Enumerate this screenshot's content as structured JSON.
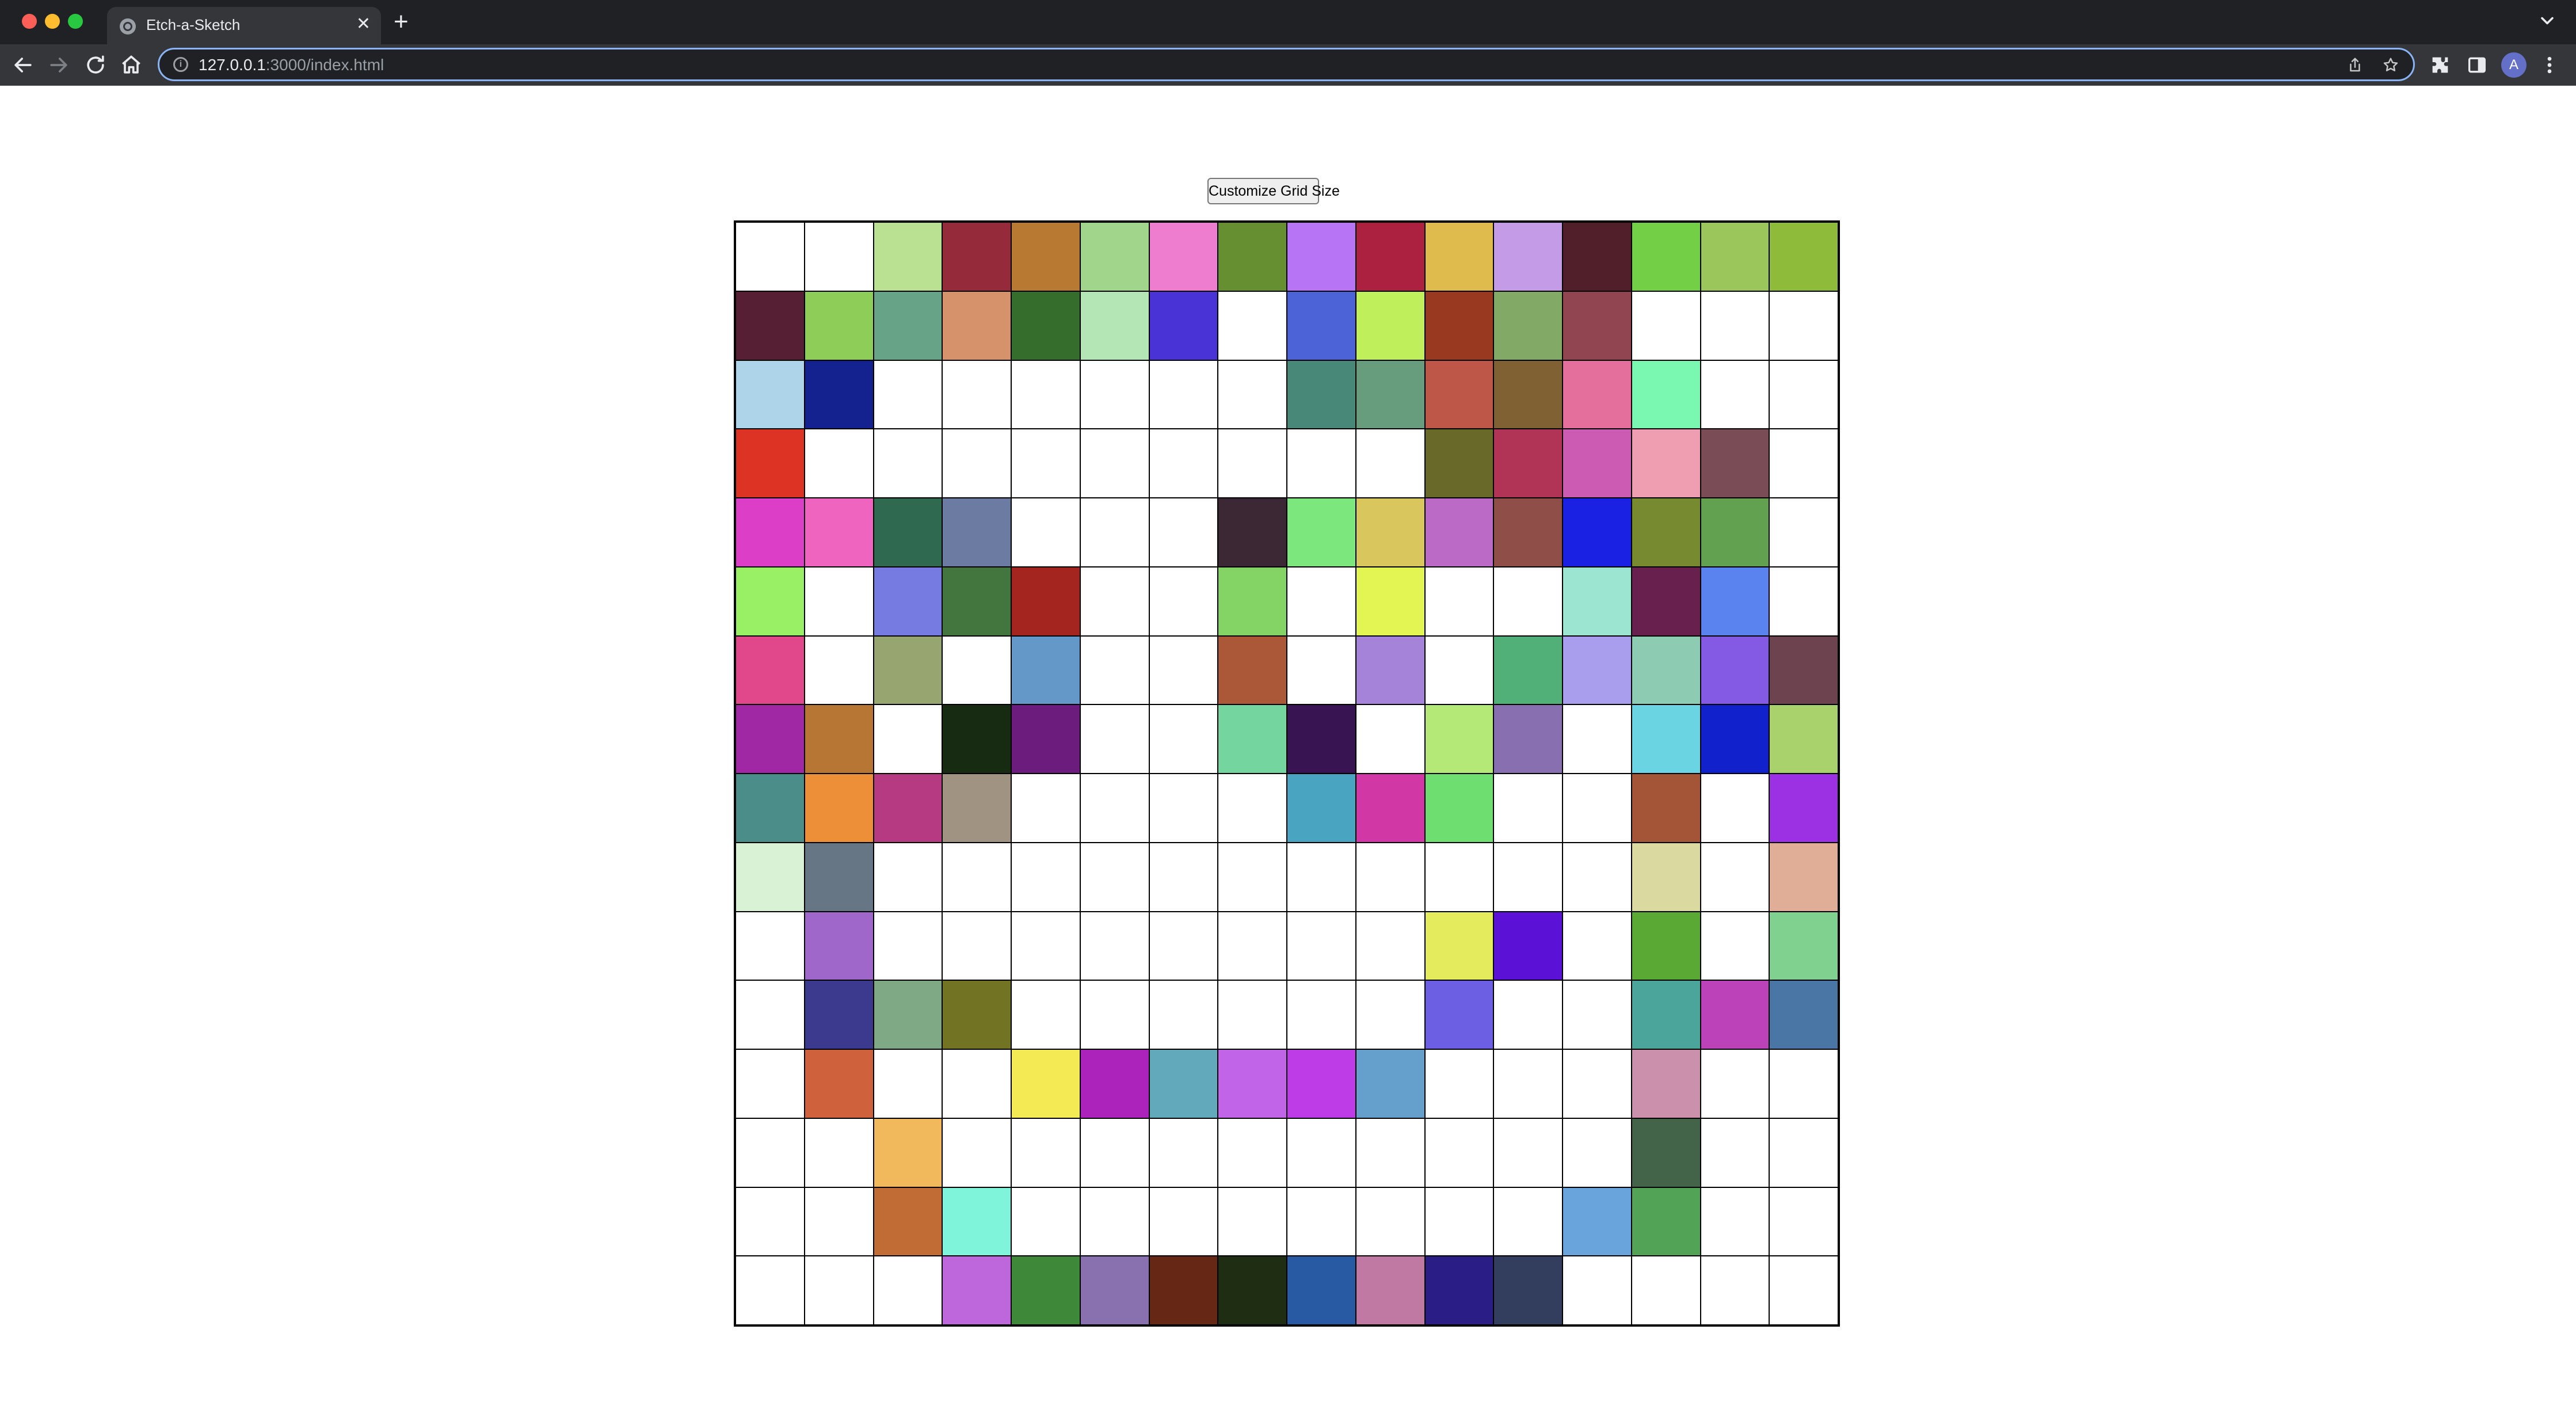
{
  "browser": {
    "tab_title": "Etch-a-Sketch",
    "url_host": "127.0.0.1",
    "url_rest": ":3000/index.html",
    "profile_initial": "A"
  },
  "page": {
    "button_label": "Customize Grid Size"
  },
  "grid": {
    "size": 16,
    "cells": [
      [
        "#ffffff",
        "#ffffff",
        "#bae091",
        "#952a3b",
        "#b87932",
        "#a0d58b",
        "#ef7dcf",
        "#658f31",
        "#b774f5",
        "#ac2140",
        "#dfbb4d",
        "#c49be6",
        "#501f29",
        "#73cf46",
        "#9bc65b",
        "#8fbb3b"
      ],
      [
        "#571f34",
        "#8fcd59",
        "#67a487",
        "#d6926b",
        "#356e2c",
        "#b4e6b5",
        "#4a33d6",
        "#ffffff",
        "#4c63d8",
        "#c0ef5c",
        "#99391f",
        "#83a967",
        "#904550",
        "#ffffff",
        "#ffffff",
        "#ffffff"
      ],
      [
        "#aed4e9",
        "#14228f",
        "#ffffff",
        "#ffffff",
        "#ffffff",
        "#ffffff",
        "#ffffff",
        "#ffffff",
        "#488879",
        "#679d7d",
        "#bf5748",
        "#7f6133",
        "#e46e9c",
        "#7af8b1",
        "#ffffff",
        "#ffffff"
      ],
      [
        "#dd3324",
        "#ffffff",
        "#ffffff",
        "#ffffff",
        "#ffffff",
        "#ffffff",
        "#ffffff",
        "#ffffff",
        "#ffffff",
        "#ffffff",
        "#696a29",
        "#b13456",
        "#cc5cb3",
        "#ef9db1",
        "#7a4d56",
        "#ffffff"
      ],
      [
        "#dc3ec8",
        "#ef64bf",
        "#2e6950",
        "#6c7ba2",
        "#ffffff",
        "#ffffff",
        "#ffffff",
        "#3b2834",
        "#7ce77d",
        "#d9c65d",
        "#bb6ac5",
        "#8f4f48",
        "#1b21e2",
        "#788a2f",
        "#62a150",
        "#ffffff"
      ],
      [
        "#99f064",
        "#ffffff",
        "#757be0",
        "#43763e",
        "#a4251f",
        "#ffffff",
        "#ffffff",
        "#83d365",
        "#ffffff",
        "#e2f553",
        "#ffffff",
        "#ffffff",
        "#9be5d1",
        "#68204e",
        "#5b83ef",
        "#ffffff"
      ],
      [
        "#e1488b",
        "#ffffff",
        "#97a670",
        "#ffffff",
        "#6398c8",
        "#ffffff",
        "#ffffff",
        "#aa5838",
        "#ffffff",
        "#a483d8",
        "#ffffff",
        "#51af78",
        "#a99ded",
        "#8ecbb3",
        "#845ae5",
        "#6d434f"
      ],
      [
        "#a128a4",
        "#b87635",
        "#ffffff",
        "#172b12",
        "#6b1c7c",
        "#ffffff",
        "#ffffff",
        "#74d59e",
        "#381453",
        "#ffffff",
        "#b4e877",
        "#8870b0",
        "#ffffff",
        "#6bd4e2",
        "#1122cc",
        "#a9d26d"
      ],
      [
        "#4b8d88",
        "#ec8f38",
        "#b63a82",
        "#a19382",
        "#ffffff",
        "#ffffff",
        "#ffffff",
        "#ffffff",
        "#49a4c1",
        "#d138a5",
        "#6ede71",
        "#ffffff",
        "#ffffff",
        "#a45538",
        "#ffffff",
        "#9b31e3"
      ],
      [
        "#d9f1d5",
        "#667684",
        "#ffffff",
        "#ffffff",
        "#ffffff",
        "#ffffff",
        "#ffffff",
        "#ffffff",
        "#ffffff",
        "#ffffff",
        "#ffffff",
        "#ffffff",
        "#ffffff",
        "#dad99f",
        "#ffffff",
        "#e0ae97"
      ],
      [
        "#ffffff",
        "#a067cb",
        "#ffffff",
        "#ffffff",
        "#ffffff",
        "#ffffff",
        "#ffffff",
        "#ffffff",
        "#ffffff",
        "#ffffff",
        "#e4eb5c",
        "#5c12d6",
        "#ffffff",
        "#5ba935",
        "#ffffff",
        "#80d090"
      ],
      [
        "#ffffff",
        "#3b3a8f",
        "#7ea984",
        "#737423",
        "#ffffff",
        "#ffffff",
        "#ffffff",
        "#ffffff",
        "#ffffff",
        "#ffffff",
        "#6d5fe3",
        "#ffffff",
        "#ffffff",
        "#4ba59b",
        "#bb42b8",
        "#4976a4"
      ],
      [
        "#ffffff",
        "#cf623c",
        "#ffffff",
        "#ffffff",
        "#f3ea54",
        "#ab23bb",
        "#62aabb",
        "#c164e8",
        "#be3ce8",
        "#65a0cd",
        "#ffffff",
        "#ffffff",
        "#ffffff",
        "#cb90ac",
        "#ffffff",
        "#ffffff"
      ],
      [
        "#ffffff",
        "#ffffff",
        "#f1b95b",
        "#ffffff",
        "#ffffff",
        "#ffffff",
        "#ffffff",
        "#ffffff",
        "#ffffff",
        "#ffffff",
        "#ffffff",
        "#ffffff",
        "#ffffff",
        "#44644a",
        "#ffffff",
        "#ffffff"
      ],
      [
        "#ffffff",
        "#ffffff",
        "#c06c34",
        "#7ff4da",
        "#ffffff",
        "#ffffff",
        "#ffffff",
        "#ffffff",
        "#ffffff",
        "#ffffff",
        "#ffffff",
        "#ffffff",
        "#69a5dc",
        "#52a356",
        "#ffffff",
        "#ffffff"
      ],
      [
        "#ffffff",
        "#ffffff",
        "#ffffff",
        "#be66dc",
        "#3e883a",
        "#8970ae",
        "#672715",
        "#1f2d12",
        "#275aa3",
        "#c079a3",
        "#2b1d86",
        "#333d5d",
        "#ffffff",
        "#ffffff",
        "#ffffff",
        "#ffffff"
      ]
    ]
  }
}
